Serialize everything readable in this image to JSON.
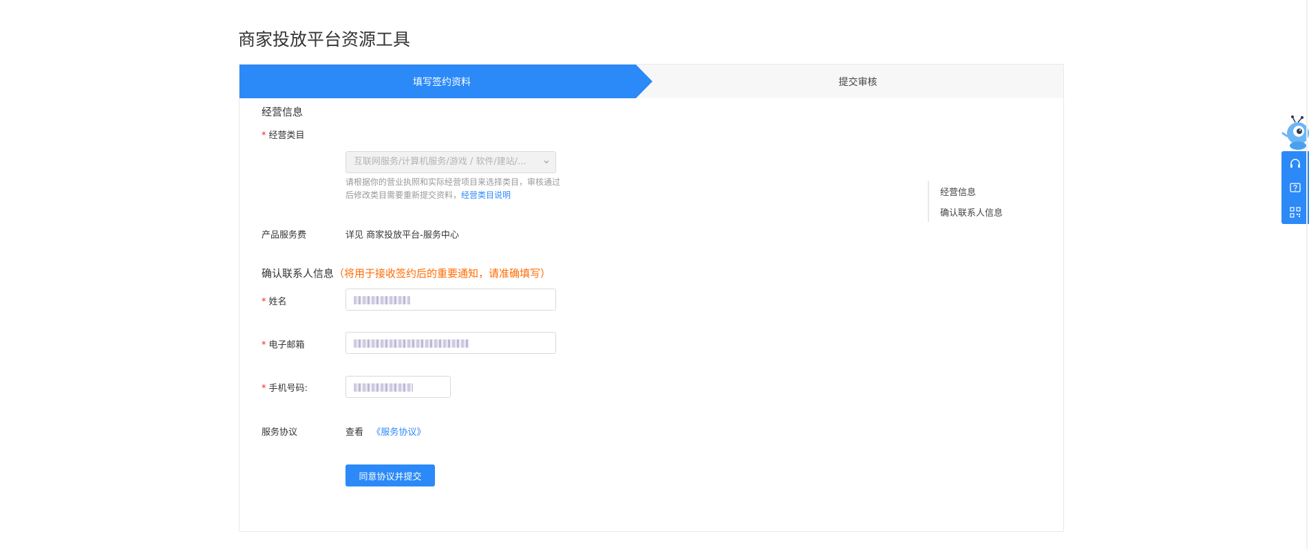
{
  "page_title": "商家投放平台资源工具",
  "steps": {
    "active": "填写签约资料",
    "next": "提交审核"
  },
  "business": {
    "section_title": "经营信息",
    "category_label": "经营类目",
    "category_value": "互联网服务/计算机服务/游戏 / 软件/建站/...",
    "hint_text": "请根据你的营业执照和实际经营项目来选择类目，审核通过后修改类目需要重新提交资料，",
    "hint_link": "经营类目说明",
    "fee_label": "产品服务费",
    "fee_value": "详见 商家投放平台-服务中心"
  },
  "contact": {
    "section_title": "确认联系人信息",
    "section_note": "（将用于接收签约后的重要通知，请准确填写）",
    "name_label": "姓名",
    "email_label": "电子邮箱",
    "phone_label": "手机号码:"
  },
  "agreement": {
    "label": "服务协议",
    "view_text": "查看",
    "link_text": "《服务协议》"
  },
  "submit_label": "同意协议并提交",
  "anchor_nav": {
    "items": [
      "经营信息",
      "确认联系人信息"
    ]
  },
  "colors": {
    "primary": "#2b89f8",
    "required": "#f5222d",
    "warning": "#ff6a00"
  }
}
